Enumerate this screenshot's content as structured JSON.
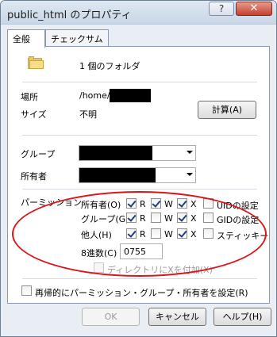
{
  "window": {
    "title": "public_html のプロパティ",
    "help_glyph": "?",
    "close_glyph": "✕"
  },
  "tabs": [
    {
      "label": "全般"
    },
    {
      "label": "チェックサム"
    }
  ],
  "general": {
    "item_count": "1 個のフォルダ",
    "location_label": "場所",
    "location_value": "/home/",
    "size_label": "サイズ",
    "size_value": "不明",
    "calc_button": "計算(A)"
  },
  "group_label": "グループ",
  "owner_label": "所有者",
  "permissions": {
    "label": "パーミッション",
    "rows": [
      {
        "label": "所有者(O)",
        "r": true,
        "w": true,
        "x": true,
        "special_label": "UIDの設定",
        "special": false
      },
      {
        "label": "グループ(G)",
        "r": true,
        "w": false,
        "x": true,
        "special_label": "GIDの設定",
        "special": false
      },
      {
        "label": "他人(H)",
        "r": true,
        "w": false,
        "x": true,
        "special_label": "スティッキー",
        "special": false
      }
    ],
    "r_label": "R",
    "w_label": "W",
    "x_label": "X",
    "octal_label": "8進数(C)",
    "octal_value": "0755",
    "dir_x_label": "ディレクトリにXを付加(X)",
    "recursive_label": "再帰的にパーミッション・グループ・所有者を設定(R)"
  },
  "buttons": {
    "ok": "OK",
    "cancel": "キャンセル",
    "help": "ヘルプ(H)"
  },
  "colors": {
    "accent_circle": "#d9161b",
    "close_red": "#c53f2e"
  }
}
